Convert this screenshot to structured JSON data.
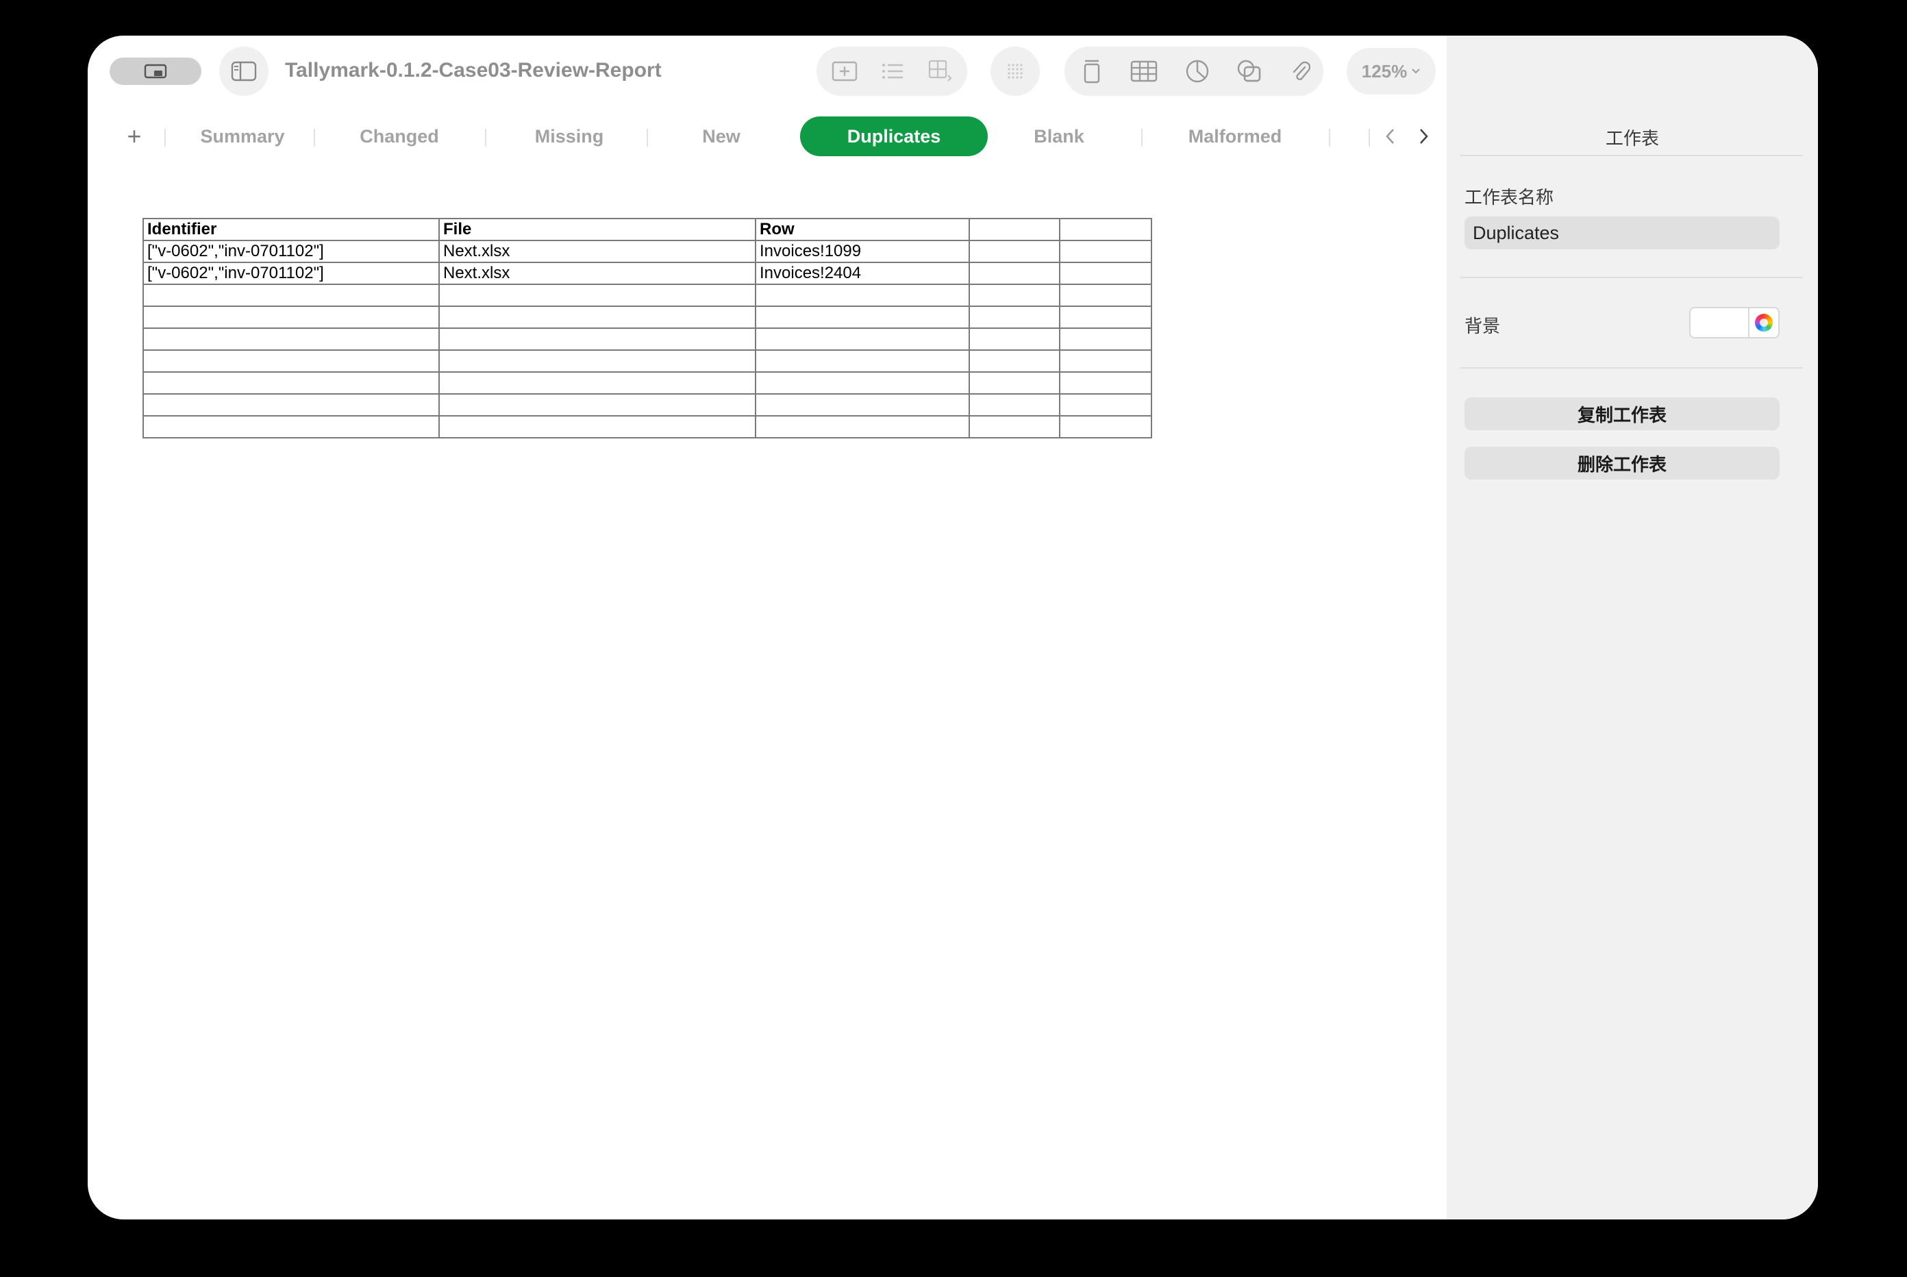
{
  "document": {
    "title": "Tallymark-0.1.2-Case03-Review-Report"
  },
  "toolbar": {
    "zoom": "125%",
    "icons": [
      "view-menu-icon",
      "sidebar-icon",
      "insert-icon",
      "list-icon",
      "table-options-icon",
      "grid-icon",
      "text-box-icon",
      "table-icon",
      "chart-icon",
      "shape-icon",
      "attachment-icon",
      "comment-icon",
      "share-icon",
      "format-brush-icon",
      "organize-icon"
    ]
  },
  "tabs": {
    "add_label": "+",
    "items": [
      {
        "label": "Summary"
      },
      {
        "label": "Changed"
      },
      {
        "label": "Missing"
      },
      {
        "label": "New"
      },
      {
        "label": "Duplicates",
        "active": true
      },
      {
        "label": "Blank"
      },
      {
        "label": "Malformed"
      }
    ]
  },
  "sheet": {
    "headers": [
      "Identifier",
      "File",
      "Row",
      "",
      ""
    ],
    "rows": [
      [
        "[\"v-0602\",\"inv-0701102\"]",
        "Next.xlsx",
        "Invoices!1099",
        "",
        ""
      ],
      [
        "[\"v-0602\",\"inv-0701102\"]",
        "Next.xlsx",
        "Invoices!2404",
        "",
        ""
      ],
      [
        "",
        "",
        "",
        "",
        ""
      ],
      [
        "",
        "",
        "",
        "",
        ""
      ],
      [
        "",
        "",
        "",
        "",
        ""
      ],
      [
        "",
        "",
        "",
        "",
        ""
      ],
      [
        "",
        "",
        "",
        "",
        ""
      ],
      [
        "",
        "",
        "",
        "",
        ""
      ],
      [
        "",
        "",
        "",
        "",
        ""
      ]
    ]
  },
  "inspector": {
    "title": "工作表",
    "name_label": "工作表名称",
    "name_value": "Duplicates",
    "background_label": "背景",
    "background_color": "#ffffff",
    "duplicate_button": "复制工作表",
    "delete_button": "删除工作表"
  },
  "colors": {
    "accent": "#0f9b46",
    "inspector_bg": "#f1f1f1"
  }
}
